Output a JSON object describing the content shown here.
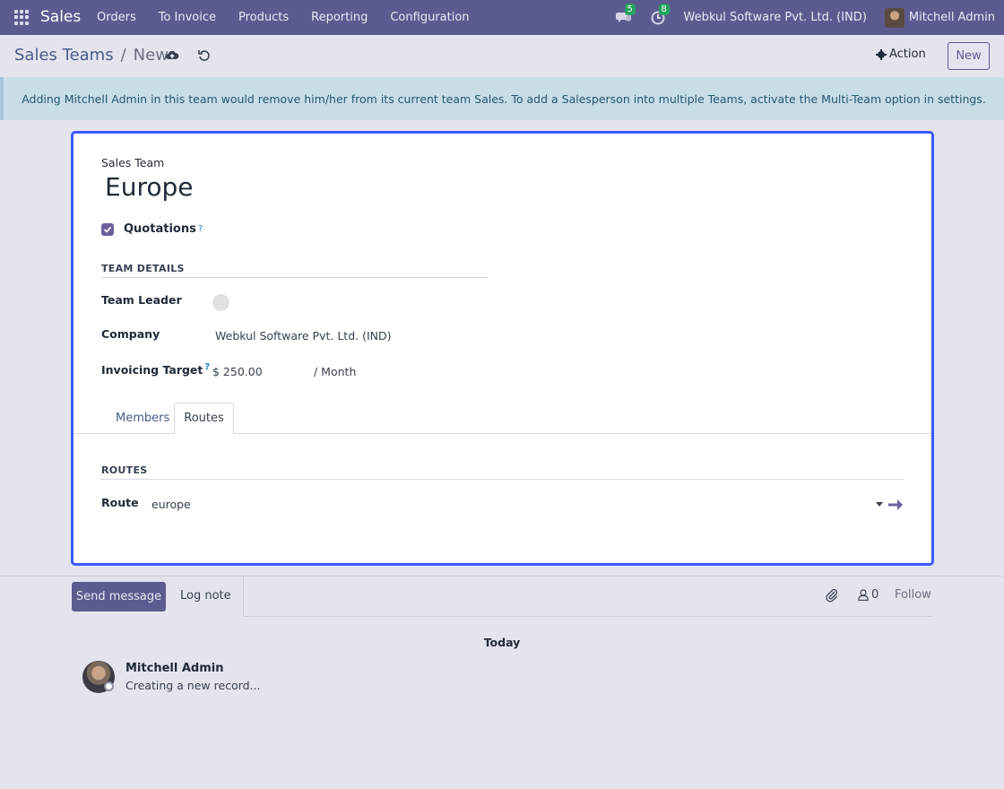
{
  "navbar": {
    "brand": "Sales",
    "menu": [
      "Orders",
      "To Invoice",
      "Products",
      "Reporting",
      "Configuration"
    ],
    "messages_badge": "5",
    "activities_badge": "8",
    "company": "Webkul Software Pvt. Ltd. (IND)",
    "user": "Mitchell Admin"
  },
  "control_panel": {
    "breadcrumb_parent": "Sales Teams",
    "breadcrumb_sep": "/",
    "breadcrumb_current": "New",
    "action_label": "Action",
    "new_label": "New"
  },
  "alert": {
    "text": "Adding Mitchell Admin in this team would remove him/her from its current team Sales. To add a Salesperson into multiple Teams, activate the Multi-Team option in settings."
  },
  "form": {
    "title_label": "Sales Team",
    "title_value": "Europe",
    "quotations_label": "Quotations",
    "quotations_checked": true,
    "help_mark": "?",
    "team_details_header": "TEAM DETAILS",
    "team_leader_label": "Team Leader",
    "company_label": "Company",
    "company_value": "Webkul Software Pvt. Ltd. (IND)",
    "invoicing_target_label": "Invoicing Target",
    "invoicing_target_value": "$ 250.00",
    "invoicing_target_unit": "/ Month",
    "tabs": [
      "Members",
      "Routes"
    ],
    "active_tab": "Routes",
    "routes_header": "ROUTES",
    "route_label": "Route",
    "route_value": "europe"
  },
  "chatter": {
    "send_message": "Send message",
    "log_note": "Log note",
    "followers_count": "0",
    "follow": "Follow",
    "today": "Today",
    "message_author": "Mitchell Admin",
    "message_body": "Creating a new record..."
  },
  "colors": {
    "navbar": "#5c5b8f",
    "highlight_border": "#3b5bff",
    "alert_bg": "#c8dde8",
    "link": "#1b84c4"
  }
}
